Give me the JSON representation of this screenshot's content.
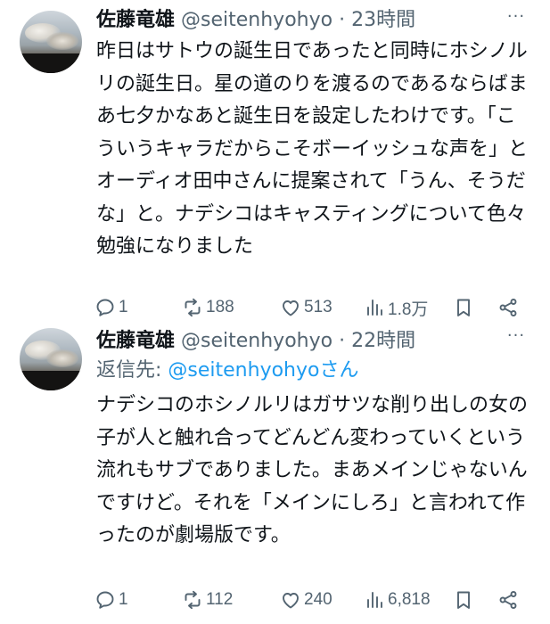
{
  "tweets": [
    {
      "name": "佐藤竜雄",
      "handle": "@seitenhyohyo",
      "dot": "·",
      "time": "23時間",
      "text": "昨日はサトウの誕生日であったと同時にホシノルリの誕生日。星の道のりを渡るのであるならばまあ七夕かなあと誕生日を設定したわけです。「こういうキャラだからこそボーイッシュな声を」とオーディオ田中さんに提案されて「うん、そうだな」と。ナデシコはキャスティングについて色々勉強になりました",
      "reply_count": "1",
      "retweet_count": "188",
      "like_count": "513",
      "view_count": "1.8万"
    },
    {
      "name": "佐藤竜雄",
      "handle": "@seitenhyohyo",
      "dot": "·",
      "time": "22時間",
      "reply_to_prefix": "返信先: ",
      "reply_to_handle": "@seitenhyohyoさん",
      "text": "ナデシコのホシノルリはガサツな削り出しの女の子が人と触れ合ってどんどん変わっていくという流れもサブでありました。まあメインじゃないんですけど。それを「メインにしろ」と言われて作ったのが劇場版です。",
      "reply_count": "1",
      "retweet_count": "112",
      "like_count": "240",
      "view_count": "6,818"
    }
  ],
  "icons": {
    "reply": "reply-icon",
    "retweet": "retweet-icon",
    "like": "heart-icon",
    "views": "views-icon",
    "bookmark": "bookmark-icon",
    "share": "share-icon",
    "more": "more-icon"
  },
  "colors": {
    "text": "#0f1419",
    "secondary": "#536471",
    "link": "#1d9bf0",
    "background": "#ffffff"
  }
}
